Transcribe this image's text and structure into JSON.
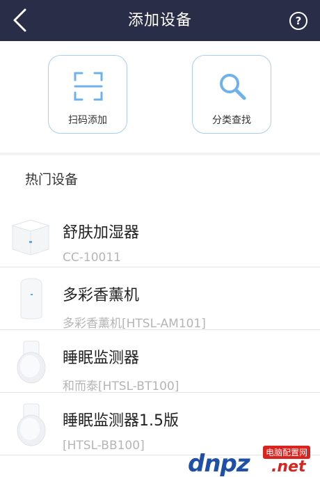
{
  "navbar": {
    "title": "添加设备",
    "back_icon": "chevron-left-icon",
    "help_icon": "help-circle-icon",
    "help_glyph": "?",
    "background": "#2a2d48"
  },
  "actions": {
    "scan": {
      "label": "扫码添加",
      "icon": "scan-frame-icon"
    },
    "category": {
      "label": "分类查找",
      "icon": "search-icon"
    },
    "accent": "#6fb2ea"
  },
  "hot_devices": {
    "title": "热门设备",
    "items": [
      {
        "name": "舒肤加湿器",
        "model": "CC-10011",
        "icon": "humidifier-image"
      },
      {
        "name": "多彩香薰机",
        "model": "多彩香薰机[HTSL-AM101]",
        "icon": "aroma-diffuser-image"
      },
      {
        "name": "睡眠监测器",
        "model": "和而泰[HTSL-BT100]",
        "icon": "sleep-monitor-image"
      },
      {
        "name": "睡眠监测器1.5版",
        "model": "[HTSL-BB100]",
        "icon": "sleep-monitor-image"
      }
    ]
  },
  "watermark": {
    "brand": "dnpz",
    "tag": "电脑配置网",
    "suffix": ".net"
  }
}
